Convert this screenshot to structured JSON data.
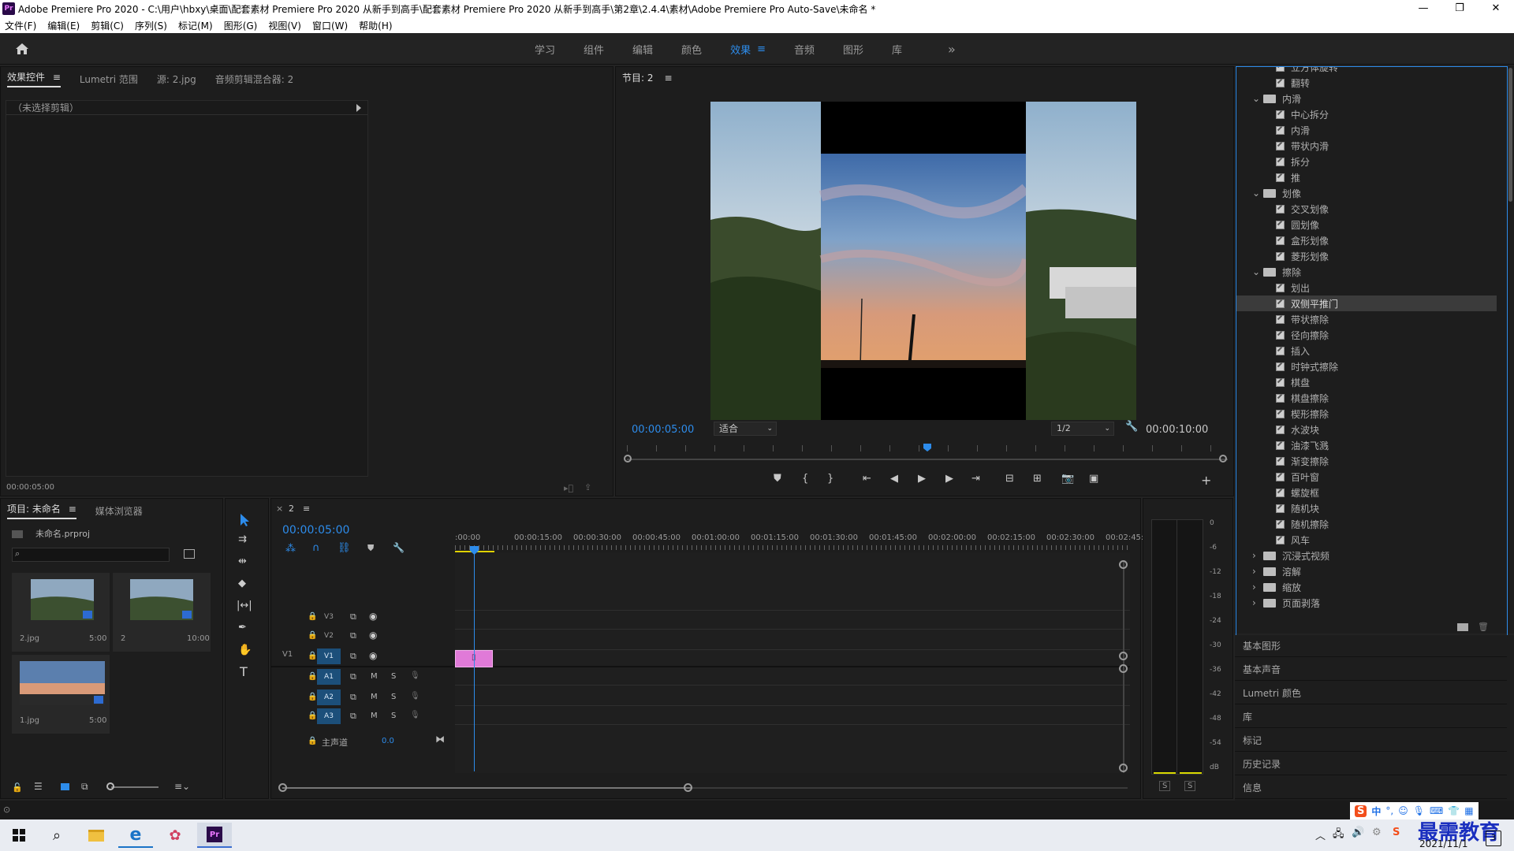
{
  "titlebar": {
    "app_icon": "Pr",
    "title": "Adobe Premiere Pro 2020 - C:\\用户\\hbxy\\桌面\\配套素材 Premiere Pro 2020 从新手到高手\\配套素材 Premiere Pro 2020 从新手到高手\\第2章\\2.4.4\\素材\\Adobe Premiere Pro Auto-Save\\未命名 *",
    "minimize": "—",
    "maximize": "❐",
    "close": "✕"
  },
  "menu": [
    "文件(F)",
    "编辑(E)",
    "剪辑(C)",
    "序列(S)",
    "标记(M)",
    "图形(G)",
    "视图(V)",
    "窗口(W)",
    "帮助(H)"
  ],
  "workspace_tabs": [
    {
      "label": "学习",
      "active": false
    },
    {
      "label": "组件",
      "active": false
    },
    {
      "label": "编辑",
      "active": false
    },
    {
      "label": "颜色",
      "active": false
    },
    {
      "label": "效果",
      "active": true
    },
    {
      "label": "音频",
      "active": false
    },
    {
      "label": "图形",
      "active": false
    },
    {
      "label": "库",
      "active": false
    }
  ],
  "workspace_more": "»",
  "workspace_menu": "≡",
  "source_panel": {
    "tabs": [
      "效果控件",
      "Lumetri 范围",
      "源: 2.jpg",
      "音频剪辑混合器: 2"
    ],
    "menu": "≡",
    "no_clip": "（未选择剪辑）",
    "time": "00:00:05:00"
  },
  "program_panel": {
    "title": "节目: 2",
    "menu": "≡",
    "current_time": "00:00:05:00",
    "fit": "适合",
    "resolution": "1/2",
    "duration": "00:00:10:00",
    "playhead_fraction": 0.5
  },
  "project_panel": {
    "tabs": [
      "项目: 未命名",
      "媒体浏览器"
    ],
    "menu": "≡",
    "project_file": "未命名.prproj",
    "search_placeholder": "",
    "items": [
      {
        "name": "2.jpg",
        "duration": "5:00"
      },
      {
        "name": "2",
        "duration": "10:00"
      },
      {
        "name": "1.jpg",
        "duration": "5:00"
      }
    ]
  },
  "timeline": {
    "close": "×",
    "sequence_tab": "2",
    "menu": "≡",
    "current_time": "00:00:05:00",
    "ruler": [
      ":00:00",
      "00:00:15:00",
      "00:00:30:00",
      "00:00:45:00",
      "00:01:00:00",
      "00:01:15:00",
      "00:01:30:00",
      "00:01:45:00",
      "00:02:00:00",
      "00:02:15:00",
      "00:02:30:00",
      "00:02:45:"
    ],
    "tracks_video": [
      "V3",
      "V2",
      "V1"
    ],
    "tracks_audio": [
      "A1",
      "A2",
      "A3"
    ],
    "source_patch": "V1",
    "mute": "M",
    "solo": "S",
    "master_label": "主声道",
    "master_value": "0.0"
  },
  "audio_meter": {
    "scale": [
      "0",
      "-6",
      "-12",
      "-18",
      "-24",
      "-30",
      "-36",
      "-42",
      "-48",
      "-54",
      "dB"
    ],
    "solo_left": "S",
    "solo_right": "S"
  },
  "effects_tree": [
    {
      "type": "item",
      "label": "立方体旋转",
      "partial": true
    },
    {
      "type": "item",
      "label": "翻转"
    },
    {
      "type": "folder",
      "label": "内滑",
      "open": true
    },
    {
      "type": "item",
      "label": "中心拆分"
    },
    {
      "type": "item",
      "label": "内滑"
    },
    {
      "type": "item",
      "label": "带状内滑"
    },
    {
      "type": "item",
      "label": "拆分"
    },
    {
      "type": "item",
      "label": "推"
    },
    {
      "type": "folder",
      "label": "划像",
      "open": true
    },
    {
      "type": "item",
      "label": "交叉划像"
    },
    {
      "type": "item",
      "label": "圆划像"
    },
    {
      "type": "item",
      "label": "盒形划像"
    },
    {
      "type": "item",
      "label": "菱形划像"
    },
    {
      "type": "folder",
      "label": "擦除",
      "open": true
    },
    {
      "type": "item",
      "label": "划出"
    },
    {
      "type": "item",
      "label": "双侧平推门",
      "selected": true
    },
    {
      "type": "item",
      "label": "带状擦除"
    },
    {
      "type": "item",
      "label": "径向擦除"
    },
    {
      "type": "item",
      "label": "插入"
    },
    {
      "type": "item",
      "label": "时钟式擦除"
    },
    {
      "type": "item",
      "label": "棋盘"
    },
    {
      "type": "item",
      "label": "棋盘擦除"
    },
    {
      "type": "item",
      "label": "楔形擦除"
    },
    {
      "type": "item",
      "label": "水波块"
    },
    {
      "type": "item",
      "label": "油漆飞溅"
    },
    {
      "type": "item",
      "label": "渐变擦除"
    },
    {
      "type": "item",
      "label": "百叶窗"
    },
    {
      "type": "item",
      "label": "螺旋框"
    },
    {
      "type": "item",
      "label": "随机块"
    },
    {
      "type": "item",
      "label": "随机擦除"
    },
    {
      "type": "item",
      "label": "风车"
    },
    {
      "type": "folder",
      "label": "沉浸式视频",
      "open": false
    },
    {
      "type": "folder",
      "label": "溶解",
      "open": false
    },
    {
      "type": "folder",
      "label": "缩放",
      "open": false
    },
    {
      "type": "folder",
      "label": "页面剥落",
      "open": false
    }
  ],
  "side_panels": [
    "基本图形",
    "基本声音",
    "Lumetri 颜色",
    "库",
    "标记",
    "历史记录",
    "信息"
  ],
  "taskbar": {
    "ime": "中",
    "ime_punct": "°,",
    "date": "2021/11/1",
    "watermark": "最需教育",
    "notification": "3"
  },
  "colors": {
    "accent": "#2d8ceb",
    "clip": "#e07ad8",
    "track_on": "#1c4f7a",
    "playhead": "#2d8ceb"
  }
}
